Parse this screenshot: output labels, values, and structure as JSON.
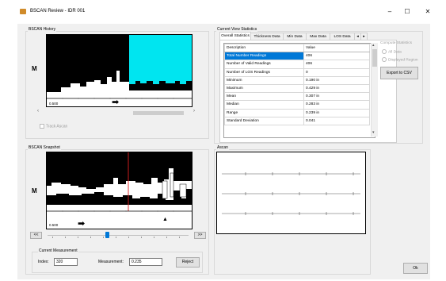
{
  "window": {
    "title": "BSCAN Review - IDR 001",
    "minimize": "–",
    "maximize": "☐",
    "close": "✕"
  },
  "bscan_history": {
    "group_title": "BSCAN History",
    "m_label": "M",
    "scale_label": "0.500",
    "arrow": "➡",
    "track_ascan_label": "Track Ascan",
    "scroll_left": "‹",
    "scroll_right": "›"
  },
  "stats": {
    "group_title": "Current View Statistics",
    "tabs": [
      "Overall Statistics",
      "Thickness Data",
      "Min Data",
      "Max Data",
      "LOS Data"
    ],
    "tab_scroll_left": "◂",
    "tab_scroll_right": "▸",
    "columns": [
      "Description",
      "Value"
    ],
    "rows": [
      [
        "Total Number Readings",
        "406"
      ],
      [
        "Number of Valid Readings",
        "406"
      ],
      [
        "Number of LOS Readings",
        "0"
      ],
      [
        "Minimum",
        "0.190 in"
      ],
      [
        "Maximum",
        "0.429 in"
      ],
      [
        "Mean",
        "0.307 in"
      ],
      [
        "Median",
        "0.283 in"
      ],
      [
        "Range",
        "0.239 in"
      ],
      [
        "Standard Deviation",
        "0.041"
      ]
    ],
    "scroll_up": "▴",
    "scroll_down": "▾",
    "compute_title": "Compute Statistics",
    "option_all": "All Data",
    "option_displayed": "Displayed Region",
    "export_button": "Export to CSV"
  },
  "snapshot": {
    "group_title": "BSCAN Snapshot",
    "m_label": "M",
    "scale_label": "0.500",
    "arrow": "➡",
    "up_marker": "▲",
    "prev_button": "<<",
    "next_button": ">>",
    "slider_position": 0.42,
    "measurement_title": "Current Measurement",
    "index_label": "Index:",
    "index_value": "320",
    "measurement_label": "Measurement:",
    "measurement_value": "0.235",
    "reject_button": "Reject"
  },
  "ascan": {
    "group_title": "Ascan"
  },
  "ok_button": "Ok",
  "colors": {
    "plot_fill": "#000000",
    "highlight": "#00e5f0",
    "cursor": "#e02020",
    "accent": "#0078d7"
  }
}
